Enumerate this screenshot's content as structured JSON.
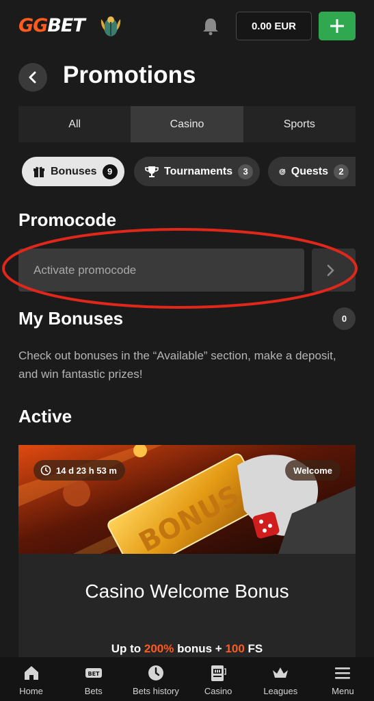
{
  "header": {
    "logo_gg": "GG",
    "logo_bet": "BET",
    "balance": "0.00 EUR",
    "icons": [
      "scarab-logo-icon",
      "bell-icon",
      "plus-icon"
    ]
  },
  "page": {
    "title": "Promotions"
  },
  "tabs": [
    {
      "label": "All"
    },
    {
      "label": "Casino"
    },
    {
      "label": "Sports"
    }
  ],
  "filters": [
    {
      "label": "Bonuses",
      "count": "9",
      "icon": "gift-icon"
    },
    {
      "label": "Tournaments",
      "count": "3",
      "icon": "trophy-icon"
    },
    {
      "label": "Quests",
      "count": "2",
      "icon": "target-icon"
    }
  ],
  "promocode": {
    "title": "Promocode",
    "placeholder": "Activate promocode",
    "highlight_color": "#e0271b"
  },
  "my_bonuses": {
    "title": "My Bonuses",
    "count": "0",
    "description": "Check out bonuses in the “Available” section, make a deposit, and win fantastic prizes!"
  },
  "active": {
    "title": "Active",
    "card": {
      "timer": "14 d 23 h 53 m",
      "tag": "Welcome",
      "banner_text": "BONUS",
      "title": "Casino Welcome Bonus",
      "sub_prefix": "Up to ",
      "sub_percent": "200%",
      "sub_middle": " bonus + ",
      "sub_fs_num": "100",
      "sub_fs": " FS"
    }
  },
  "bottom_nav": [
    {
      "label": "Home",
      "icon": "home-icon"
    },
    {
      "label": "Bets",
      "icon": "bet-ticket-icon"
    },
    {
      "label": "Bets history",
      "icon": "clock-icon"
    },
    {
      "label": "Casino",
      "icon": "slot-machine-icon"
    },
    {
      "label": "Leagues",
      "icon": "crown-icon"
    },
    {
      "label": "Menu",
      "icon": "menu-icon"
    }
  ],
  "colors": {
    "accent_orange": "#ff5a1f",
    "green": "#2fa84f",
    "background": "#1b1b1b"
  }
}
